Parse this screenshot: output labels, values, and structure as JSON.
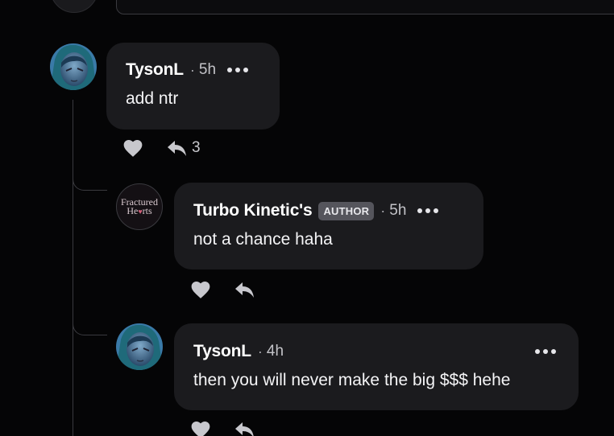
{
  "comments": [
    {
      "author": "TysonL",
      "time": "5h",
      "text": "add ntr",
      "reply_count": "3"
    },
    {
      "author": "Turbo Kinetic's",
      "badge": "AUTHOR",
      "time": "5h",
      "text": "not a chance haha",
      "avatar_logo": {
        "line1": "Fractured",
        "line2_start": "He",
        "line2_heart": "♥",
        "line2_end": "rts"
      }
    },
    {
      "author": "TysonL",
      "time": "4h",
      "text": "then you will never make the big $$$ hehe"
    }
  ],
  "separator": "·",
  "icons": {
    "like": "heart-icon",
    "reply": "reply-arrow-icon",
    "more": "more-options-icon"
  },
  "colors": {
    "background": "#050506",
    "bubble": "#1b1b1e",
    "badge": "#55555c",
    "icon": "#c8c8cd"
  }
}
